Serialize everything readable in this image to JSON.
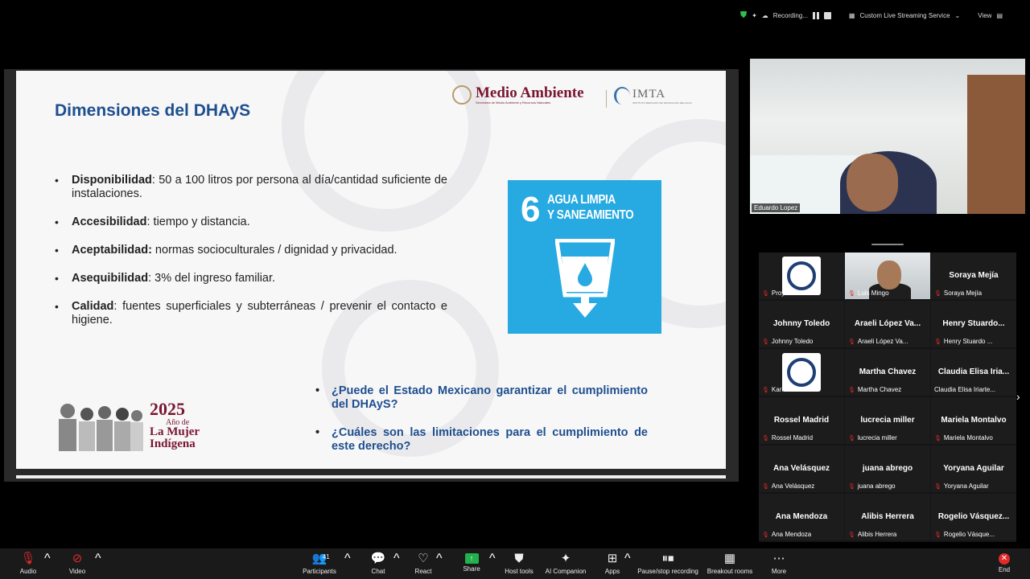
{
  "top_bar": {
    "recording_label": "Recording...",
    "stream_label": "Custom Live Streaming Service",
    "view_label": "View"
  },
  "slide": {
    "title": "Dimensiones del DHAyS",
    "logo_ma_name": "Medio Ambiente",
    "logo_ma_sub": "Secretaría de Medio Ambiente y Recursos Naturales",
    "logo_imta_name": "IMTA",
    "logo_imta_sub": "INSTITUTO MEXICANO DE TECNOLOGÍA DEL AGUA",
    "bullets": [
      {
        "term": "Disponibilidad",
        "text": ":  50 a 100 litros por persona al día/cantidad suficiente de instalaciones."
      },
      {
        "term": "Accesibilidad",
        "text": ": tiempo y distancia."
      },
      {
        "term": "Aceptabilidad:",
        "text": " normas socioculturales / dignidad y privacidad."
      },
      {
        "term": "Asequibilidad",
        "text": ": 3% del ingreso familiar."
      },
      {
        "term": "Calidad",
        "text": ": fuentes superficiales y subterráneas / prevenir el contacto e higiene."
      }
    ],
    "sdg_number": "6",
    "sdg_line1": "AGUA LIMPIA",
    "sdg_line2": "Y SANEAMIENTO",
    "year": "2025",
    "mujer_line1": "Año de",
    "mujer_line2": "La Mujer",
    "mujer_line3": "Indígena",
    "questions": [
      "¿Puede el Estado Mexicano garantizar el cumplimiento del DHAyS?",
      "¿Cuáles son las limitaciones para el cumplimiento de este derecho?"
    ]
  },
  "speaker": {
    "name": "Eduardo Lopez"
  },
  "gallery": [
    {
      "big": "",
      "small": "Proyecto Meso...",
      "type": "logo"
    },
    {
      "big": "",
      "small": "Luis Mingo",
      "type": "camera"
    },
    {
      "big": "Soraya Mejía",
      "small": "Soraya Mejía",
      "type": "name"
    },
    {
      "big": "Johnny Toledo",
      "small": "Johnny Toledo",
      "type": "name"
    },
    {
      "big": "Araeli López Va...",
      "small": "Araeli López Va...",
      "type": "name"
    },
    {
      "big": "Henry  Stuardo...",
      "small": "Henry Stuardo ...",
      "type": "name"
    },
    {
      "big": "",
      "small": "Karla",
      "type": "logo"
    },
    {
      "big": "Martha Chavez",
      "small": "Martha Chavez",
      "type": "name"
    },
    {
      "big": "Claudia Elisa Iria...",
      "small": "Claudia Elisa Iriarte...",
      "type": "name"
    },
    {
      "big": "Rossel Madrid",
      "small": "Rossel Madrid",
      "type": "name"
    },
    {
      "big": "lucrecia miller",
      "small": "lucrecia miller",
      "type": "name"
    },
    {
      "big": "Mariela Montalvo",
      "small": "Mariela Montalvo",
      "type": "name"
    },
    {
      "big": "Ana Velásquez",
      "small": "Ana Velásquez",
      "type": "name"
    },
    {
      "big": "juana abrego",
      "small": "juana abrego",
      "type": "name"
    },
    {
      "big": "Yoryana Aguilar",
      "small": "Yoryana Aguilar",
      "type": "name"
    },
    {
      "big": "Ana Mendoza",
      "small": "Ana Mendoza",
      "type": "name"
    },
    {
      "big": "Alibis Herrera",
      "small": "Alibis Herrera",
      "type": "name"
    },
    {
      "big": "Rogelio  Vásquez...",
      "small": "Rogelio Vásque...",
      "type": "name"
    }
  ],
  "toolbar": {
    "audio": "Audio",
    "video": "Video",
    "participants": "Participants",
    "participants_count": "41",
    "chat": "Chat",
    "react": "React",
    "share": "Share",
    "host_tools": "Host tools",
    "ai_companion": "AI Companion",
    "apps": "Apps",
    "pause_recording": "Pause/stop recording",
    "breakout": "Breakout rooms",
    "more": "More",
    "end": "End"
  },
  "colors": {
    "slide_title": "#1e4f8f",
    "sdg_blue": "#27a9e1",
    "brand_maroon": "#7a1631",
    "mic_muted": "#e02a2a",
    "share_green": "#22b14c"
  }
}
